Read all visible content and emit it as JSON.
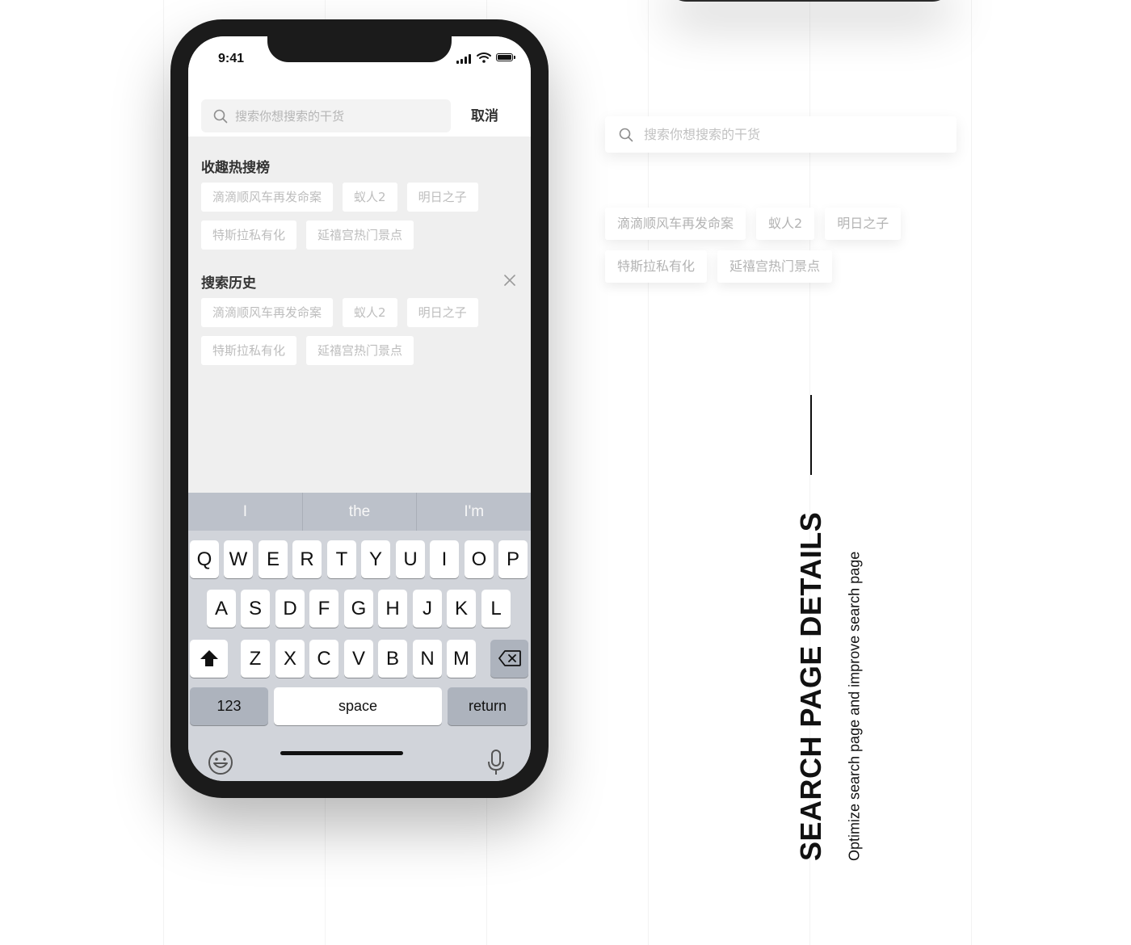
{
  "status_bar": {
    "time": "9:41"
  },
  "search": {
    "placeholder": "搜索你想搜索的干货",
    "cancel_label": "取消"
  },
  "hot_list": {
    "title": "收趣热搜榜",
    "tags": [
      "滴滴顺风车再发命案",
      "蚁人2",
      "明日之子",
      "特斯拉私有化",
      "延禧宫热门景点"
    ]
  },
  "history": {
    "title": "搜索历史",
    "tags": [
      "滴滴顺风车再发命案",
      "蚁人2",
      "明日之子",
      "特斯拉私有化",
      "延禧宫热门景点"
    ]
  },
  "keyboard": {
    "suggestions": [
      "I",
      "the",
      "I'm"
    ],
    "row1": [
      "Q",
      "W",
      "E",
      "R",
      "T",
      "Y",
      "U",
      "I",
      "O",
      "P"
    ],
    "row2": [
      "A",
      "S",
      "D",
      "F",
      "G",
      "H",
      "J",
      "K",
      "L"
    ],
    "row3": [
      "Z",
      "X",
      "C",
      "V",
      "B",
      "N",
      "M"
    ],
    "numbers_label": "123",
    "space_label": "space",
    "return_label": "return"
  },
  "detail_panel": {
    "search_placeholder": "搜索你想搜索的干货",
    "tags": [
      "滴滴顺风车再发命案",
      "蚁人2",
      "明日之子",
      "特斯拉私有化",
      "延禧宫热门景点"
    ]
  },
  "section": {
    "title": "SEARCH PAGE DETAILS",
    "subtitle": "Optimize search page and improve search page"
  }
}
